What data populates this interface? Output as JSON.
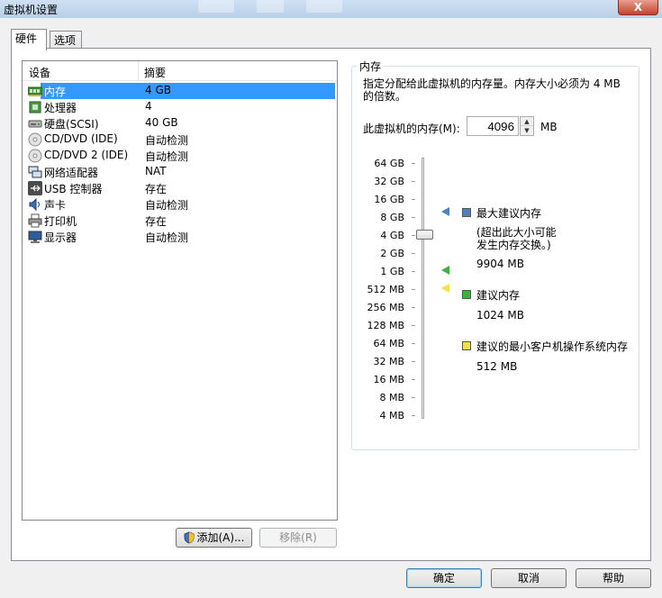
{
  "window": {
    "title": "虚拟机设置",
    "close_label": "X"
  },
  "tabs": [
    {
      "label": "硬件"
    },
    {
      "label": "选项"
    }
  ],
  "device_list": {
    "headers": {
      "device": "设备",
      "summary": "摘要"
    },
    "rows": [
      {
        "name": "内存",
        "summary": "4 GB",
        "icon": "memory-icon",
        "selected": true
      },
      {
        "name": "处理器",
        "summary": "4",
        "icon": "processor-icon"
      },
      {
        "name": "硬盘(SCSI)",
        "summary": "40 GB",
        "icon": "hard-disk-icon"
      },
      {
        "name": "CD/DVD (IDE)",
        "summary": "自动检测",
        "icon": "cd-dvd-icon"
      },
      {
        "name": "CD/DVD 2 (IDE)",
        "summary": "自动检测",
        "icon": "cd-dvd-icon"
      },
      {
        "name": "网络适配器",
        "summary": "NAT",
        "icon": "network-adapter-icon"
      },
      {
        "name": "USB 控制器",
        "summary": "存在",
        "icon": "usb-icon"
      },
      {
        "name": "声卡",
        "summary": "自动检测",
        "icon": "sound-card-icon"
      },
      {
        "name": "打印机",
        "summary": "存在",
        "icon": "printer-icon"
      },
      {
        "name": "显示器",
        "summary": "自动检测",
        "icon": "monitor-icon"
      }
    ]
  },
  "buttons": {
    "add": "添加(A)...",
    "remove": "移除(R)",
    "ok": "确定",
    "cancel": "取消",
    "help": "帮助"
  },
  "memory": {
    "group_title": "内存",
    "description": "指定分配给此虚拟机的内存量。内存大小必须为 4 MB 的倍数。",
    "field_label": "此虚拟机的内存(M):",
    "value": "4096",
    "unit": "MB",
    "slider_ticks": [
      "64 GB",
      "32 GB",
      "16 GB",
      "8 GB",
      "4 GB",
      "2 GB",
      "1 GB",
      "512 MB",
      "256 MB",
      "128 MB",
      "64 MB",
      "32 MB",
      "16 MB",
      "8 MB",
      "4 MB"
    ],
    "slider_value_label": "4 GB",
    "legend": {
      "max": {
        "title": "最大建议内存",
        "note": "(超出此大小可能发生内存交换。)",
        "value": "9904 MB",
        "color": "#4f81bd"
      },
      "recommended": {
        "title": "建议内存",
        "value": "1024 MB",
        "color": "#3cb33c"
      },
      "min": {
        "title": "建议的最小客户机操作系统内存",
        "value": "512 MB",
        "color": "#f2e24a"
      }
    }
  }
}
